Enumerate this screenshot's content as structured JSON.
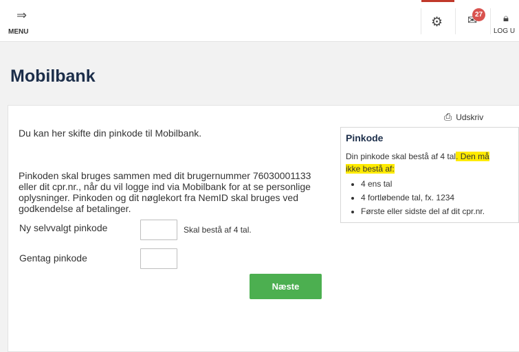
{
  "header": {
    "menu_label": "MENU",
    "menu_icon": "menu-icon",
    "settings_icon": "gear-icon",
    "mail_icon": "mail-icon",
    "mail_count": "27",
    "logout_label": "LOG U",
    "logout_icon": "lock-icon"
  },
  "page": {
    "title": "Mobilbank"
  },
  "print": {
    "label": "Udskriv",
    "icon": "printer-icon"
  },
  "intro": {
    "line1": "Du kan her skifte din pinkode til Mobilbank.",
    "line2": "Pinkoden skal bruges sammen med dit brugernummer 76030001133 eller dit cpr.nr., når du vil logge ind via Mobilbank for at se personlige oplysninger. Pinkoden og dit nøglekort fra NemID skal bruges ved godkendelse af betalinger."
  },
  "form": {
    "new_pin_label": "Ny selvvalgt pinkode",
    "new_pin_value": "",
    "new_pin_hint": "Skal bestå af 4 tal.",
    "repeat_pin_label": "Gentag pinkode",
    "repeat_pin_value": "",
    "next_button": "Næste"
  },
  "info": {
    "title": "Pinkode",
    "text_plain": "Din pinkode skal bestå af 4 tal",
    "text_highlight_1": ". Den må",
    "text_highlight_2": "ikke bestå af:",
    "items": [
      "4 ens tal",
      "4 fortløbende tal, fx. 1234",
      "Første eller sidste del af dit cpr.nr."
    ]
  },
  "colors": {
    "accent_green": "#4caf50",
    "title_navy": "#1c2e4a",
    "badge_red": "#d9534f",
    "highlight_yellow": "#ffeb00",
    "active_tab_red": "#c0392b"
  }
}
